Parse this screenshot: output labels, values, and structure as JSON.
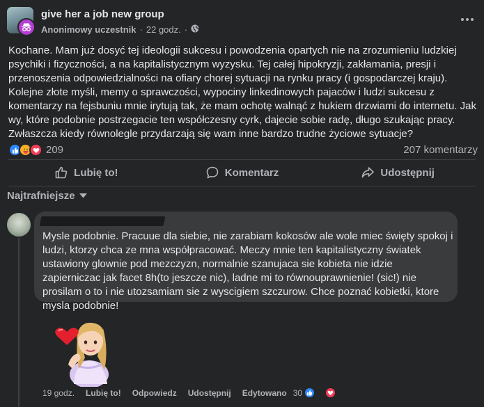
{
  "post": {
    "group_name": "give her a job new group",
    "author": "Anonimowy uczestnik",
    "separator": "·",
    "time": "22 godz.",
    "separator2": "·",
    "icons": {
      "more": "more-horizontal-icon",
      "audience": "globe-icon",
      "anonymous": "incognito-icon"
    },
    "text": "Kochane. Mam już dosyć tej ideologii sukcesu i powodzenia opartych nie na zrozumieniu ludzkiej psychiki i fizyczności, a na kapitalistycznym wyzysku. Tej całej hipokryzji, zakłamania, presji i przenoszenia odpowiedzialności na ofiary chorej sytuacji na rynku pracy (i gospodarczej kraju). Kolejne złote myśli, memy o sprawczości, wypociny linkedinowych pajaców i ludzi sukcesu z komentarzy na fejsbuniu mnie irytują tak, że mam ochotę walnąć z hukiem drzwiami do internetu. Jak wy, które podobnie postrzegacie ten współczesny cyrk, dajecie sobie radę, długo szukając pracy. Zwłaszcza kiedy równolegle przydarzają się wam inne bardzo trudne życiowe sytuacje?",
    "reaction_count": "209",
    "comment_count": "207 komentarzy",
    "reaction_types": [
      "like",
      "care",
      "love"
    ]
  },
  "actions": {
    "like": "Lubię to!",
    "comment": "Komentarz",
    "share": "Udostępnij"
  },
  "sort": {
    "label": "Najtrafniejsze"
  },
  "comment": {
    "text": "Mysle podobnie. Pracuue dla siebie, nie zarabiam kokosów ale wole miec święty spokoj i ludzi, ktorzy chca ze mna współpracować. Meczy mnie ten kapitalistyczny światek ustawiony glownie pod mezczyzn, normalnie szanujaca sie kobieta nie idzie zapierniczac jak facet 8h(to jeszcze nic), ladne mi to równouprawnienie! (sic!) nie prosilam o to i nie utozsamiam sie z wyscigiem szczurow. Chce poznać kobietki, ktore mysla podobnie!",
    "time": "19 godz.",
    "like": "Lubię to!",
    "reply": "Odpowiedz",
    "share": "Udostępnij",
    "edited": "Edytowano",
    "reaction_count": "30",
    "reaction_types": [
      "like",
      "love"
    ],
    "sticker": "avatar-heart-sticker"
  },
  "colors": {
    "background": "#242526",
    "bubble": "#3a3b3c",
    "text": "#e4e6eb",
    "secondary_text": "#b0b3b8",
    "like_blue": "#2d88ff",
    "love_red": "#f33e58",
    "care_yellow": "#f7b125",
    "anonymous_purple": "#b33ed3"
  }
}
